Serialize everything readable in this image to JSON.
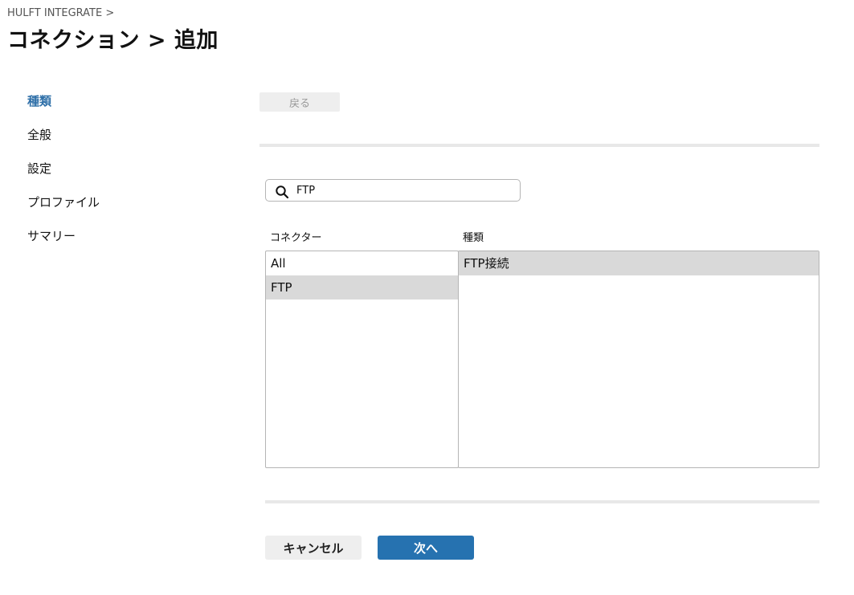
{
  "breadcrumb": "HULFT INTEGRATE >",
  "page_title": "コネクション > 追加",
  "steps": [
    {
      "label": "種類",
      "active": true
    },
    {
      "label": "全般",
      "active": false
    },
    {
      "label": "設定",
      "active": false
    },
    {
      "label": "プロファイル",
      "active": false
    },
    {
      "label": "サマリー",
      "active": false
    }
  ],
  "back_label": "戻る",
  "search": {
    "value": "FTP",
    "icon": "search-icon"
  },
  "columns": {
    "connector": "コネクター",
    "kind": "種類"
  },
  "connector_list": [
    {
      "label": "All",
      "selected": false
    },
    {
      "label": "FTP",
      "selected": true
    }
  ],
  "kind_list": [
    {
      "label": "FTP接続",
      "selected": true
    }
  ],
  "buttons": {
    "cancel": "キャンセル",
    "next": "次へ"
  },
  "colors": {
    "accent": "#2672b0",
    "active_step": "#2e6fa8",
    "selected_row": "#d9d9d9"
  }
}
